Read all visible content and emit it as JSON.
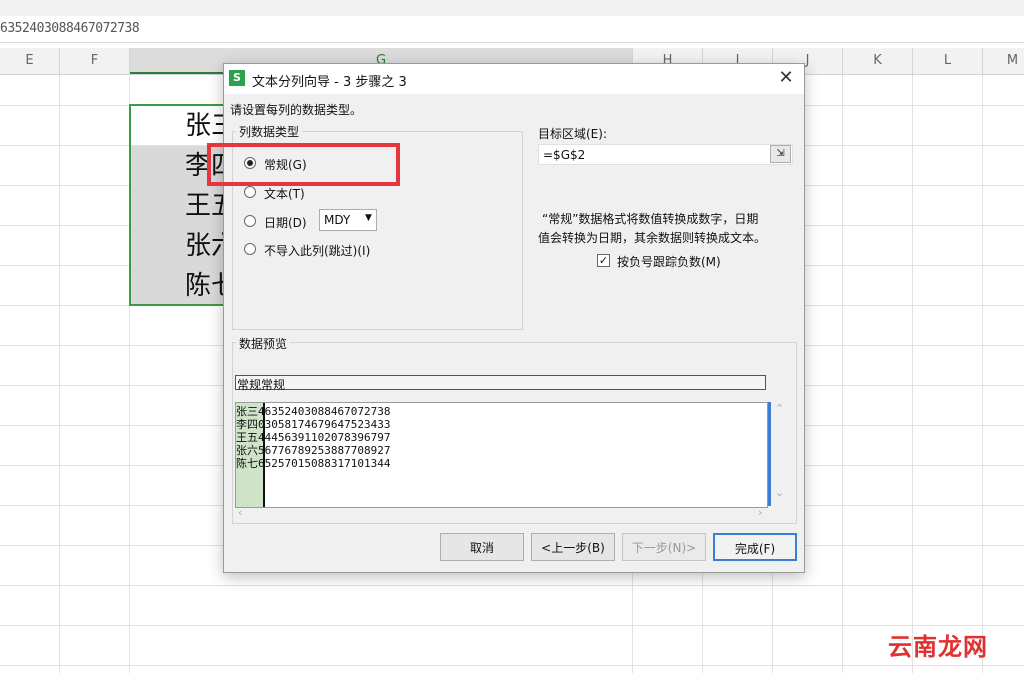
{
  "formula_bar": {
    "value": "6352403088467072738"
  },
  "columns": [
    {
      "id": "E",
      "label": "E"
    },
    {
      "id": "F",
      "label": "F"
    },
    {
      "id": "G",
      "label": "G"
    },
    {
      "id": "H",
      "label": "H"
    },
    {
      "id": "I",
      "label": "I"
    },
    {
      "id": "J",
      "label": "J"
    },
    {
      "id": "K",
      "label": "K"
    },
    {
      "id": "L",
      "label": "L"
    },
    {
      "id": "M",
      "label": "M"
    }
  ],
  "cells": [
    "张三",
    "李四",
    "王五",
    "张六",
    "陈七"
  ],
  "dialog": {
    "title": "文本分列向导 - 3 步骤之 3",
    "icon": "S",
    "instruction": "请设置每列的数据类型。",
    "group_label": "列数据类型",
    "radios": [
      {
        "label": "常规(G)",
        "checked": true
      },
      {
        "label": "文本(T)",
        "checked": false
      },
      {
        "label": "日期(D)",
        "checked": false
      },
      {
        "label": "不导入此列(跳过)(I)",
        "checked": false
      }
    ],
    "date_format": "MDY",
    "target_label": "目标区域(E):",
    "target_value": "=$G$2",
    "description_line1": "“常规”数据格式将数值转换成数字，日期",
    "description_line2": "值会转换为日期，其余数据则转换成文本。",
    "checkbox_label": "按负号跟踪负数(M)",
    "checkbox_checked": true,
    "preview_label": "数据预览",
    "preview_header": "常规常规",
    "preview_rows": [
      {
        "name": "张三",
        "value": "4635240308846707273​8"
      },
      {
        "name": "李四",
        "value": "0305817467964752343​3"
      },
      {
        "name": "王五",
        "value": "4445639110207839679​7"
      },
      {
        "name": "张六",
        "value": "5677678925388770892​7"
      },
      {
        "name": "陈七",
        "value": "6525701508831710134​4"
      }
    ],
    "buttons": {
      "cancel": "取消",
      "back": "<上一步(B)",
      "next": "下一步(N)>",
      "finish": "完成(F)"
    }
  },
  "watermark": "云南龙网",
  "colors": {
    "accent_green": "#2e9e4f",
    "highlight_red": "#e4363d",
    "primary_blue": "#3b7fd4"
  }
}
